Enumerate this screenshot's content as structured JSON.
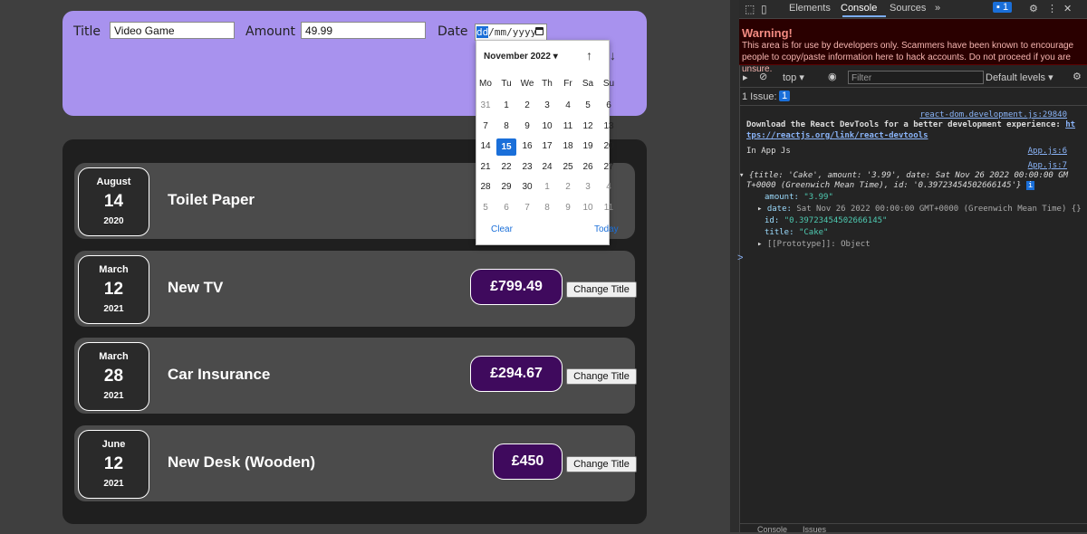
{
  "form": {
    "title_label": "Title",
    "title_value": "Video Game",
    "amount_label": "Amount",
    "amount_value": "49.99",
    "date_label": "Date",
    "date_seg": "dd",
    "date_rest": "/mm/yyyy"
  },
  "calendar": {
    "month": "November 2022",
    "up_arrow": "↑",
    "down_arrow": "↓",
    "dow": [
      "Mo",
      "Tu",
      "We",
      "Th",
      "Fr",
      "Sa",
      "Su"
    ],
    "weeks": [
      [
        "31",
        "1",
        "2",
        "3",
        "4",
        "5",
        "6"
      ],
      [
        "7",
        "8",
        "9",
        "10",
        "11",
        "12",
        "13"
      ],
      [
        "14",
        "15",
        "16",
        "17",
        "18",
        "19",
        "20"
      ],
      [
        "21",
        "22",
        "23",
        "24",
        "25",
        "26",
        "27"
      ],
      [
        "28",
        "29",
        "30",
        "1",
        "2",
        "3",
        "4"
      ],
      [
        "5",
        "6",
        "7",
        "8",
        "9",
        "10",
        "11"
      ]
    ],
    "selected": "15",
    "clear": "Clear",
    "today": "Today"
  },
  "expenses": [
    {
      "month": "August",
      "day": "14",
      "year": "2020",
      "title": "Toilet Paper",
      "amount": "",
      "button": "Change Title"
    },
    {
      "month": "March",
      "day": "12",
      "year": "2021",
      "title": "New TV",
      "amount": "£799.49",
      "button": "Change Title"
    },
    {
      "month": "March",
      "day": "28",
      "year": "2021",
      "title": "Car Insurance",
      "amount": "£294.67",
      "button": "Change Title"
    },
    {
      "month": "June",
      "day": "12",
      "year": "2021",
      "title": "New Desk (Wooden)",
      "amount": "£450",
      "button": "Change Title"
    }
  ],
  "devtools": {
    "tabs": [
      "Elements",
      "Console",
      "Sources"
    ],
    "more": "»",
    "badge": "1",
    "warning_title": "Warning!",
    "warning_msg": "This area is for use by developers only. Scammers have been known to encourage people to copy/paste information here to hack accounts. Do not proceed if you are unsure.",
    "context": "top ▾",
    "filter_placeholder": "Filter",
    "levels": "Default levels ▾",
    "issues_label": "1 Issue:",
    "issues_count": "1",
    "src1": "react-dom.development.js:29840",
    "devtools_msg1": "Download the React DevTools for a better development experience: ",
    "devtools_link1": "ht",
    "devtools_link2": "tps://reactjs.org/link/react-devtools",
    "log1": "In App Js",
    "src2": "App.js:6",
    "src3": "App.js:7",
    "obj_line1": "{title: 'Cake', amount: '3.99', date: Sat Nov 26 2022 00:00:00 GM",
    "obj_line2": "T+0000 (Greenwich Mean Time), id: '0.39723454502666145'}",
    "prop_amount_key": "amount: ",
    "prop_amount_val": "\"3.99\"",
    "prop_date_key": "date: ",
    "prop_date_val": "Sat Nov 26 2022 00:00:00 GMT+0000 (Greenwich Mean Time) {}",
    "prop_id_key": "id: ",
    "prop_id_val": "\"0.39723454502666145\"",
    "prop_title_key": "title: ",
    "prop_title_val": "\"Cake\"",
    "prop_proto": "[[Prototype]]: Object",
    "bottom_tabs": [
      "Console",
      "Issues"
    ]
  },
  "colors": {
    "form_bg": "#a892ee",
    "price_bg": "#3f0a5d",
    "accent": "#1a6fd9"
  }
}
